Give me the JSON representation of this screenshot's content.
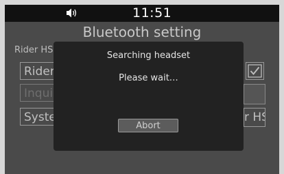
{
  "status_bar": {
    "volume_icon": "speaker-icon",
    "time": "11:51"
  },
  "background": {
    "title": "Bluetooth setting",
    "section_label": "Rider HS",
    "rows": [
      {
        "label": "Rider",
        "enabled": true
      },
      {
        "label": "Inquiry",
        "enabled": false
      },
      {
        "label": "System",
        "enabled": true
      }
    ],
    "checkbox_checked": true,
    "right_button_label": "r HS"
  },
  "dialog": {
    "title": "Searching headset",
    "message": "Please wait…",
    "abort_label": "Abort"
  },
  "colors": {
    "screen_bg": "#4a4a4a",
    "dialog_bg": "#222222",
    "status_bg": "#111111"
  }
}
